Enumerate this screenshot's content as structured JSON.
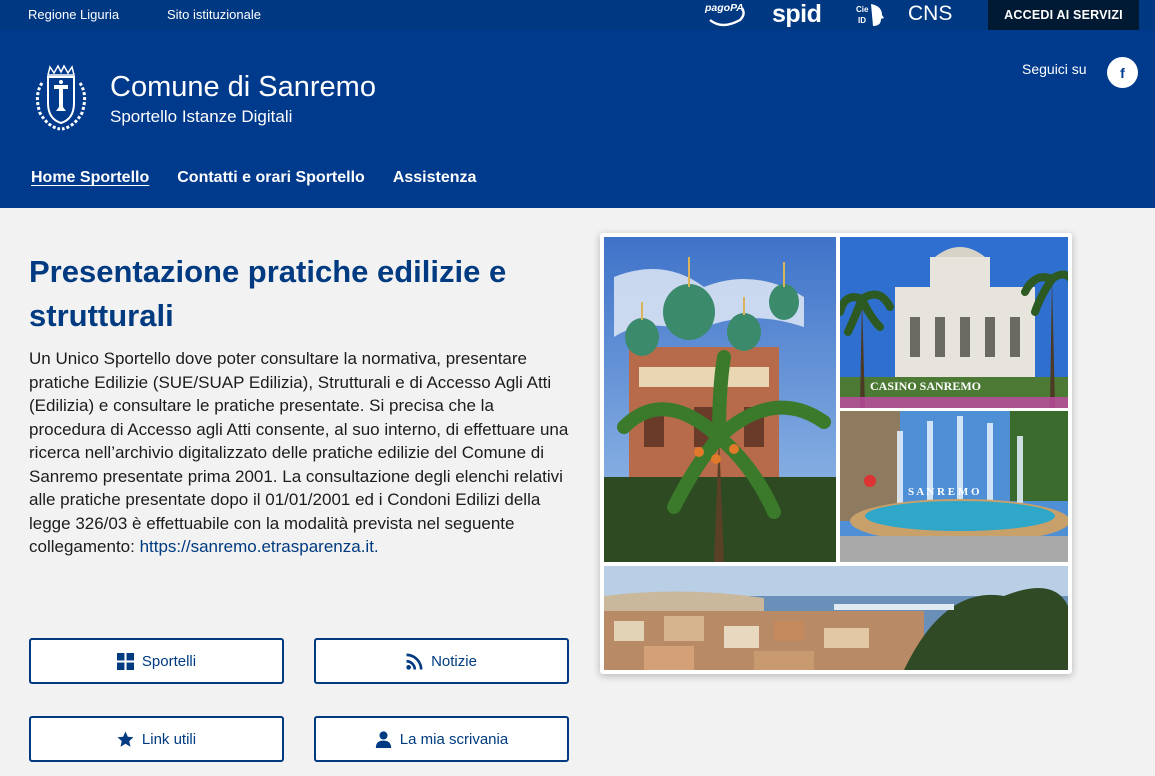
{
  "topbar": {
    "link_regione": "Regione Liguria",
    "link_sito": "Sito istituzionale",
    "logo_pagopa": "pagoPA",
    "logo_spid": "spid",
    "logo_cie": "CIE ID",
    "logo_cns": "CNS",
    "accedi_label": "ACCEDI AI SERVIZI"
  },
  "header": {
    "title": "Comune di Sanremo",
    "subtitle": "Sportello Istanze Digitali",
    "follow_label": "Seguici su",
    "facebook_label": "f"
  },
  "nav": {
    "items": [
      {
        "label": "Home Sportello"
      },
      {
        "label": "Contatti e orari Sportello"
      },
      {
        "label": "Assistenza"
      }
    ]
  },
  "main": {
    "heading": "Presentazione pratiche edilizie e strutturali",
    "intro": "Un Unico Sportello dove poter consultare la normativa, presentare pratiche Edilizie (SUE/SUAP Edilizia), Strutturali e di Accesso Agli Atti (Edilizia) e consultare le pratiche presentate. Si precisa che la procedura di Accesso agli Atti consente, al suo interno, di effettuare una ricerca nell’archivio digitalizzato delle pratiche edilizie del Comune di Sanremo presentate prima 2001. La consultazione degli elenchi relativi alle pratiche presentate dopo il 01/01/2001 ed i Condoni Edilizi della legge 326/03 è effettuabile con la modalità prevista nel seguente collegamento: ",
    "link_text": "https://sanremo.etrasparenza.it.",
    "buttons": {
      "sportelli": "Sportelli",
      "notizie": "Notizie",
      "link_utili": "Link utili",
      "scrivania": "La mia scrivania"
    }
  },
  "icons": {
    "sportelli": "grid-icon",
    "notizie": "rss-icon",
    "link_utili": "star-icon",
    "scrivania": "user-icon"
  },
  "colors": {
    "brand": "#003a8c",
    "topbar": "#003882",
    "accedi_bg": "#001a33",
    "heading": "#003a80"
  }
}
